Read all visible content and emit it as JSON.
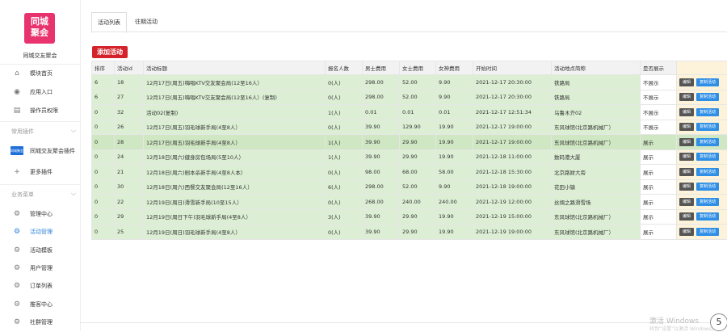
{
  "brand": {
    "logo_line1": "同城",
    "logo_line2": "聚会",
    "name": "同城交友聚会"
  },
  "sidebar": {
    "top_items": [
      {
        "label": "模块首页",
        "icon": "home-icon"
      },
      {
        "label": "应用入口",
        "icon": "chat-icon"
      },
      {
        "label": "操作员权限",
        "icon": "file-icon"
      }
    ],
    "section_plugins": "常用插件",
    "plugin_item": {
      "label": "同城交友聚会插件",
      "icon_text": "同城聚会"
    },
    "more_plugins": "更多插件",
    "section_business": "业务菜单",
    "business_items": [
      {
        "label": "管理中心",
        "icon": "gear-icon"
      },
      {
        "label": "活动管理",
        "icon": "gear-icon",
        "active": true
      },
      {
        "label": "活动模板",
        "icon": "gear-icon"
      },
      {
        "label": "用户管理",
        "icon": "gear-icon"
      },
      {
        "label": "订单列表",
        "icon": "gear-icon"
      },
      {
        "label": "推客中心",
        "icon": "gear-icon"
      },
      {
        "label": "社群管理",
        "icon": "gear-icon"
      }
    ]
  },
  "tabs": [
    {
      "label": "活动列表",
      "active": true
    },
    {
      "label": "往期活动",
      "active": false
    }
  ],
  "add_button": "添加活动",
  "table": {
    "headers": [
      "排序",
      "活动id",
      "活动标题",
      "报名人数",
      "男士费用",
      "女士费用",
      "女神费用",
      "开始时间",
      "活动地点简称",
      "是否展示",
      ""
    ],
    "edit_label": "编辑",
    "copy_label": "复制活动",
    "rows": [
      [
        "6",
        "18",
        "12月17日(周五)嗨唱KTV交友聚会局(12至16人）",
        "0(人)",
        "298.00",
        "52.00",
        "9.90",
        "2021-12-17 20:30:00",
        "铁路局",
        "不展示"
      ],
      [
        "6",
        "27",
        "12月17日(周五)嗨唱KTV交友聚会局(12至16人）(复制)",
        "0(人)",
        "298.00",
        "52.00",
        "9.90",
        "2021-12-17 20:30:00",
        "铁路局",
        "不展示"
      ],
      [
        "0",
        "32",
        "活动02(复制)",
        "1(人)",
        "0.01",
        "0.01",
        "0.01",
        "2021-12-17 12:51:34",
        "乌鲁木齐02",
        "不展示"
      ],
      [
        "0",
        "26",
        "12月17日(周五)羽毛球新手局(4至8人）",
        "0(人)",
        "39.90",
        "129.90",
        "19.90",
        "2021-12-17 19:00:00",
        "东风球馆(北京路机械厂）",
        "不展示"
      ],
      [
        "0",
        "28",
        "12月17日(周五)羽毛球新手局(4至8人）",
        "1(人)",
        "39.90",
        "29.90",
        "19.90",
        "2021-12-17 19:00:00",
        "东风球馆(北京路机械厂）",
        "展示"
      ],
      [
        "0",
        "24",
        "12月18日(周六)健身房包场局(5至10人）",
        "1(人)",
        "39.90",
        "29.90",
        "19.90",
        "2021-12-18 11:00:00",
        "数码港大厦",
        "展示"
      ],
      [
        "0",
        "21",
        "12月18日(周六)剧本杀新手局(4至8人本）",
        "0(人)",
        "98.00",
        "68.00",
        "58.00",
        "2021-12-18 15:30:00",
        "北京路财大旁",
        "展示"
      ],
      [
        "0",
        "30",
        "12月18日(周六)西餐交友聚会局(12至16人）",
        "6(人)",
        "298.00",
        "52.00",
        "9.90",
        "2021-12-18 19:00:00",
        "花田小镇",
        "展示"
      ],
      [
        "0",
        "22",
        "12月19日(周日)滑雪新手局(10至15人）",
        "0(人)",
        "268.00",
        "240.00",
        "240.00",
        "2021-12-19 12:00:00",
        "丝绸之路滑雪场",
        "展示"
      ],
      [
        "0",
        "29",
        "12月19日(周日下午)羽毛球新手局(4至8人）",
        "3(人)",
        "39.90",
        "29.90",
        "19.90",
        "2021-12-19 15:00:00",
        "东风球馆(北京路机械厂）",
        "展示"
      ],
      [
        "0",
        "25",
        "12月19日(周日)羽毛球新手局(4至8人）",
        "0(人)",
        "39.90",
        "29.90",
        "19.90",
        "2021-12-19 19:00:00",
        "东风球馆(北京路机械厂）",
        "展示"
      ]
    ]
  },
  "watermark": {
    "line1": "激活 Windows",
    "line2": "转到“设置”以激活 Windows。",
    "badge": "5"
  },
  "colors": {
    "brand_pink": "#e8336f",
    "add_button_red": "#d4232a",
    "row_green": "#dcefd4",
    "ops_yellow": "#fdf3da",
    "edit_button": "#555555",
    "copy_button": "#2f8fe6",
    "active_menu_blue": "#2e83d8"
  }
}
